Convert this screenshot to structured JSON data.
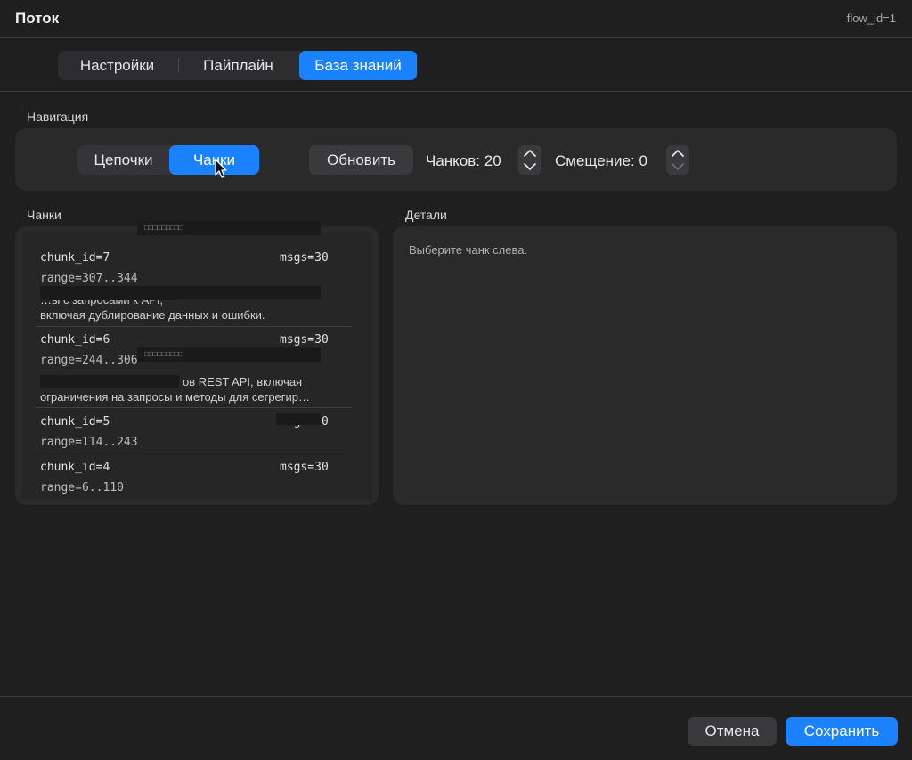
{
  "window": {
    "title": "Поток",
    "flow_id": "flow_id=1"
  },
  "tabs": [
    {
      "label": "Настройки",
      "active": false
    },
    {
      "label": "Пайплайн",
      "active": false
    },
    {
      "label": "База знаний",
      "active": true
    }
  ],
  "navigation": {
    "label": "Навигация",
    "mode_options": [
      {
        "label": "Цепочки",
        "active": false
      },
      {
        "label": "Чанки",
        "active": true
      }
    ],
    "refresh_label": "Обновить",
    "chunks_count_label": "Чанков: 20",
    "offset_label": "Смещение: 0"
  },
  "chunks": {
    "label": "Чанки",
    "tooltip_text": "□□□□□□□□□",
    "items": [
      {
        "id": "chunk_id=7",
        "msgs": "msgs=30",
        "range": "range=307..344",
        "summary": [
          "…ы с запросами к API,",
          "включая дублирование данных и ошибки."
        ]
      },
      {
        "id": "chunk_id=6",
        "msgs": "msgs=30",
        "range": "range=244..306",
        "summary": [
          "ов REST API, включая",
          "ограничения на запросы и методы для сегрегир…"
        ]
      },
      {
        "id": "chunk_id=5",
        "msgs": "msgs=30",
        "range": "range=114..243",
        "summary": []
      },
      {
        "id": "chunk_id=4",
        "msgs": "msgs=30",
        "range": "range=6..110",
        "summary": []
      }
    ]
  },
  "details": {
    "label": "Детали",
    "placeholder": "Выберите чанк слева."
  },
  "footer": {
    "cancel_label": "Отмена",
    "save_label": "Сохранить"
  },
  "colors": {
    "accent": "#1a82ff",
    "background": "#1f1f20",
    "panel": "#2a2a2b"
  }
}
